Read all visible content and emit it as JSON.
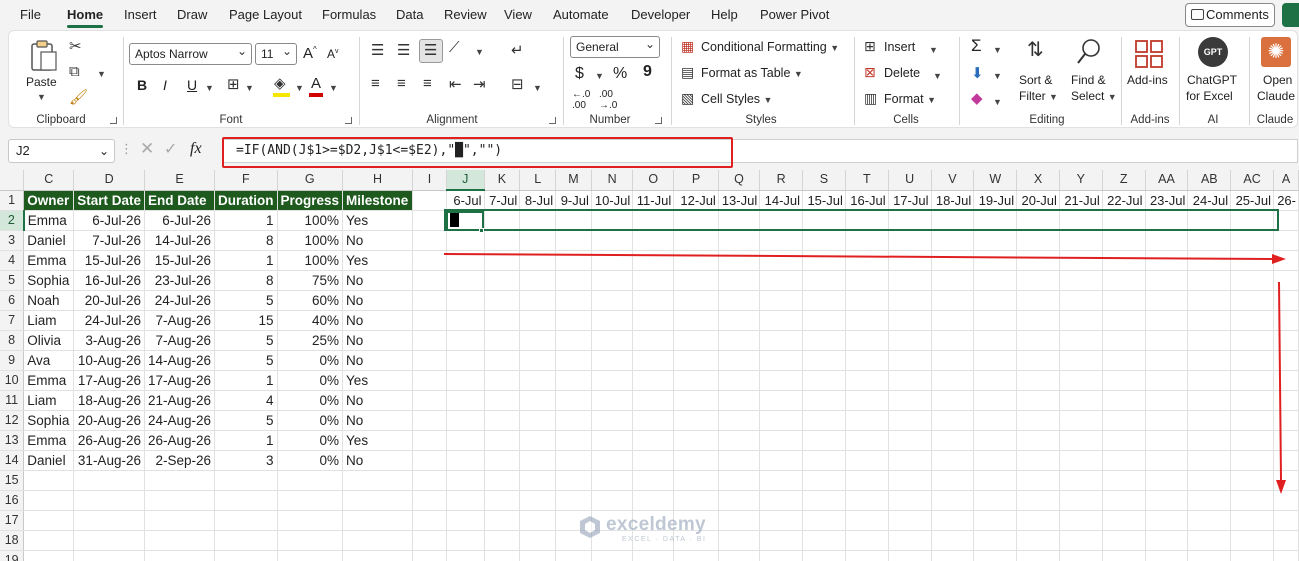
{
  "menu": {
    "tabs": [
      "File",
      "Home",
      "Insert",
      "Draw",
      "Page Layout",
      "Formulas",
      "Data",
      "Review",
      "View",
      "Automate",
      "Developer",
      "Help",
      "Power Pivot"
    ],
    "active": "Home",
    "comments_label": "Comments"
  },
  "ribbon": {
    "clipboard": {
      "label": "Clipboard",
      "paste": "Paste"
    },
    "font": {
      "label": "Font",
      "name": "Aptos Narrow",
      "size": "11",
      "bold": "B",
      "italic": "I",
      "underline": "U",
      "grow": "A",
      "shrink": "A"
    },
    "alignment": {
      "label": "Alignment"
    },
    "number": {
      "label": "Number",
      "format": "General",
      "currency": "$",
      "percent": "%",
      "comma": "9"
    },
    "styles": {
      "label": "Styles",
      "conditional": "Conditional Formatting",
      "table": "Format as Table",
      "cell": "Cell Styles"
    },
    "cells": {
      "label": "Cells",
      "insert": "Insert",
      "delete": "Delete",
      "format": "Format"
    },
    "editing": {
      "label": "Editing",
      "sum": "Σ",
      "sort1": "Sort &",
      "sort2": "Filter",
      "find1": "Find &",
      "find2": "Select"
    },
    "addins": {
      "label": "Add-ins",
      "btn": "Add-ins"
    },
    "ai": {
      "label": "AI",
      "btn1": "ChatGPT",
      "btn2": "for Excel",
      "logo": "GPT"
    },
    "claude": {
      "label": "Claude",
      "btn1": "Open",
      "btn2": "Claude"
    }
  },
  "formula_bar": {
    "name_box": "J2",
    "fx": "fx",
    "formula": "=IF(AND(J$1>=$D2,J$1<=$E2),\"█\",\"\")"
  },
  "sheet": {
    "col_letters": [
      "C",
      "D",
      "E",
      "F",
      "G",
      "H",
      "I",
      "J",
      "K",
      "L",
      "M",
      "N",
      "O",
      "P",
      "Q",
      "R",
      "S",
      "T",
      "U",
      "V",
      "W",
      "X",
      "Y",
      "Z",
      "AA",
      "AB",
      "AC",
      "A"
    ],
    "headers": [
      "Owner",
      "Start Date",
      "End Date",
      "Duration",
      "Progress",
      "Milestone"
    ],
    "timeline": [
      "6-Jul",
      "7-Jul",
      "8-Jul",
      "9-Jul",
      "10-Jul",
      "11-Jul",
      "12-Jul",
      "13-Jul",
      "14-Jul",
      "15-Jul",
      "16-Jul",
      "17-Jul",
      "18-Jul",
      "19-Jul",
      "20-Jul",
      "21-Jul",
      "22-Jul",
      "23-Jul",
      "24-Jul",
      "25-Jul",
      "26-"
    ],
    "rows": [
      [
        "Emma",
        "6-Jul-26",
        "6-Jul-26",
        "1",
        "100%",
        "Yes"
      ],
      [
        "Daniel",
        "7-Jul-26",
        "14-Jul-26",
        "8",
        "100%",
        "No"
      ],
      [
        "Emma",
        "15-Jul-26",
        "15-Jul-26",
        "1",
        "100%",
        "Yes"
      ],
      [
        "Sophia",
        "16-Jul-26",
        "23-Jul-26",
        "8",
        "75%",
        "No"
      ],
      [
        "Noah",
        "20-Jul-26",
        "24-Jul-26",
        "5",
        "60%",
        "No"
      ],
      [
        "Liam",
        "24-Jul-26",
        "7-Aug-26",
        "15",
        "40%",
        "No"
      ],
      [
        "Olivia",
        "3-Aug-26",
        "7-Aug-26",
        "5",
        "25%",
        "No"
      ],
      [
        "Ava",
        "10-Aug-26",
        "14-Aug-26",
        "5",
        "0%",
        "No"
      ],
      [
        "Emma",
        "17-Aug-26",
        "17-Aug-26",
        "1",
        "0%",
        "Yes"
      ],
      [
        "Liam",
        "18-Aug-26",
        "21-Aug-26",
        "4",
        "0%",
        "No"
      ],
      [
        "Sophia",
        "20-Aug-26",
        "24-Aug-26",
        "5",
        "0%",
        "No"
      ],
      [
        "Emma",
        "26-Aug-26",
        "26-Aug-26",
        "1",
        "0%",
        "Yes"
      ],
      [
        "Daniel",
        "31-Aug-26",
        "2-Sep-26",
        "3",
        "0%",
        "No"
      ]
    ],
    "row_numbers": [
      "1",
      "2",
      "3",
      "4",
      "5",
      "6",
      "7",
      "8",
      "9",
      "10",
      "11",
      "12",
      "13",
      "14",
      "15",
      "16",
      "17",
      "18",
      "19"
    ],
    "active_cell_value": "█"
  },
  "watermark": {
    "name": "exceldemy",
    "tag": "EXCEL · DATA · BI"
  }
}
